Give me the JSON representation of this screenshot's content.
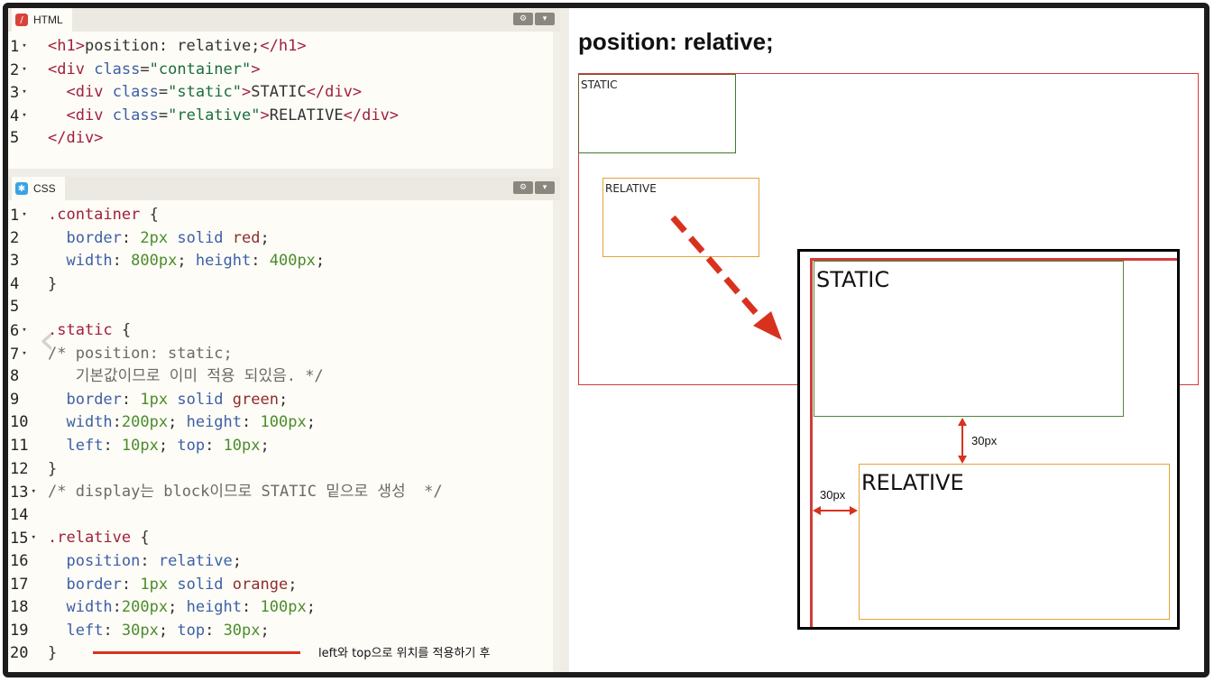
{
  "html_pane": {
    "tab_label": "HTML",
    "tab_icon": "html-icon",
    "settings_icon": "gear-icon",
    "toggle_icon": "chevron-down-icon",
    "lines": [
      {
        "n": "1",
        "fold": true,
        "tokens": [
          [
            "t",
            "<h1>"
          ],
          [
            "d",
            "position: relative;"
          ],
          [
            "t",
            "</h1>"
          ]
        ]
      },
      {
        "n": "2",
        "fold": true,
        "tokens": [
          [
            "t",
            "<div"
          ],
          [
            "d",
            " "
          ],
          [
            "p",
            "class"
          ],
          [
            "d",
            "="
          ],
          [
            "s",
            "\"container\""
          ],
          [
            "t",
            ">"
          ]
        ]
      },
      {
        "n": "3",
        "fold": true,
        "tokens": [
          [
            "d",
            "  "
          ],
          [
            "t",
            "<div"
          ],
          [
            "d",
            " "
          ],
          [
            "p",
            "class"
          ],
          [
            "d",
            "="
          ],
          [
            "s",
            "\"static\""
          ],
          [
            "t",
            ">"
          ],
          [
            "d",
            "STATIC"
          ],
          [
            "t",
            "</div>"
          ]
        ]
      },
      {
        "n": "4",
        "fold": true,
        "tokens": [
          [
            "d",
            "  "
          ],
          [
            "t",
            "<div"
          ],
          [
            "d",
            " "
          ],
          [
            "p",
            "class"
          ],
          [
            "d",
            "="
          ],
          [
            "s",
            "\"relative\""
          ],
          [
            "t",
            ">"
          ],
          [
            "d",
            "RELATIVE"
          ],
          [
            "t",
            "</div>"
          ]
        ]
      },
      {
        "n": "5",
        "fold": false,
        "tokens": [
          [
            "t",
            "</div>"
          ]
        ]
      }
    ]
  },
  "css_pane": {
    "tab_label": "CSS",
    "tab_icon": "css-icon",
    "settings_icon": "gear-icon",
    "toggle_icon": "chevron-down-icon",
    "lines": [
      {
        "n": "1",
        "fold": true,
        "tokens": [
          [
            "sel",
            ".container"
          ],
          [
            "d",
            " {"
          ]
        ]
      },
      {
        "n": "2",
        "fold": false,
        "tokens": [
          [
            "d",
            "  "
          ],
          [
            "p",
            "border"
          ],
          [
            "d",
            ": "
          ],
          [
            "v",
            "2px"
          ],
          [
            "d",
            " "
          ],
          [
            "p",
            "solid"
          ],
          [
            "d",
            " "
          ],
          [
            "k",
            "red"
          ],
          [
            "d",
            ";"
          ]
        ]
      },
      {
        "n": "3",
        "fold": false,
        "tokens": [
          [
            "d",
            "  "
          ],
          [
            "p",
            "width"
          ],
          [
            "d",
            ": "
          ],
          [
            "v",
            "800px"
          ],
          [
            "d",
            "; "
          ],
          [
            "p",
            "height"
          ],
          [
            "d",
            ": "
          ],
          [
            "v",
            "400px"
          ],
          [
            "d",
            ";"
          ]
        ]
      },
      {
        "n": "4",
        "fold": false,
        "tokens": [
          [
            "d",
            "}"
          ]
        ]
      },
      {
        "n": "5",
        "fold": false,
        "tokens": []
      },
      {
        "n": "6",
        "fold": true,
        "tokens": [
          [
            "sel",
            ".static"
          ],
          [
            "d",
            " {"
          ]
        ]
      },
      {
        "n": "7",
        "fold": true,
        "tokens": [
          [
            "c",
            "/* position: static;"
          ]
        ]
      },
      {
        "n": "8",
        "fold": false,
        "tokens": [
          [
            "c",
            "   기본값이므로 이미 적용 되있음. */"
          ]
        ]
      },
      {
        "n": "9",
        "fold": false,
        "tokens": [
          [
            "d",
            "  "
          ],
          [
            "p",
            "border"
          ],
          [
            "d",
            ": "
          ],
          [
            "v",
            "1px"
          ],
          [
            "d",
            " "
          ],
          [
            "p",
            "solid"
          ],
          [
            "d",
            " "
          ],
          [
            "k",
            "green"
          ],
          [
            "d",
            ";"
          ]
        ]
      },
      {
        "n": "10",
        "fold": false,
        "tokens": [
          [
            "d",
            "  "
          ],
          [
            "p",
            "width"
          ],
          [
            "d",
            ":"
          ],
          [
            "v",
            "200px"
          ],
          [
            "d",
            "; "
          ],
          [
            "p",
            "height"
          ],
          [
            "d",
            ": "
          ],
          [
            "v",
            "100px"
          ],
          [
            "d",
            ";"
          ]
        ]
      },
      {
        "n": "11",
        "fold": false,
        "tokens": [
          [
            "d",
            "  "
          ],
          [
            "p",
            "left"
          ],
          [
            "d",
            ": "
          ],
          [
            "v",
            "10px"
          ],
          [
            "d",
            "; "
          ],
          [
            "p",
            "top"
          ],
          [
            "d",
            ": "
          ],
          [
            "v",
            "10px"
          ],
          [
            "d",
            ";"
          ]
        ]
      },
      {
        "n": "12",
        "fold": false,
        "tokens": [
          [
            "d",
            "}"
          ]
        ]
      },
      {
        "n": "13",
        "fold": true,
        "tokens": [
          [
            "c",
            "/* display는 block이므로 STATIC 밑으로 생성  */"
          ]
        ]
      },
      {
        "n": "14",
        "fold": false,
        "tokens": []
      },
      {
        "n": "15",
        "fold": true,
        "tokens": [
          [
            "sel",
            ".relative"
          ],
          [
            "d",
            " {"
          ]
        ]
      },
      {
        "n": "16",
        "fold": false,
        "tokens": [
          [
            "d",
            "  "
          ],
          [
            "p",
            "position"
          ],
          [
            "d",
            ": "
          ],
          [
            "p",
            "relative"
          ],
          [
            "d",
            ";"
          ]
        ]
      },
      {
        "n": "17",
        "fold": false,
        "tokens": [
          [
            "d",
            "  "
          ],
          [
            "p",
            "border"
          ],
          [
            "d",
            ": "
          ],
          [
            "v",
            "1px"
          ],
          [
            "d",
            " "
          ],
          [
            "p",
            "solid"
          ],
          [
            "d",
            " "
          ],
          [
            "k",
            "orange"
          ],
          [
            "d",
            ";"
          ]
        ]
      },
      {
        "n": "18",
        "fold": false,
        "tokens": [
          [
            "d",
            "  "
          ],
          [
            "p",
            "width"
          ],
          [
            "d",
            ":"
          ],
          [
            "v",
            "200px"
          ],
          [
            "d",
            "; "
          ],
          [
            "p",
            "height"
          ],
          [
            "d",
            ": "
          ],
          [
            "v",
            "100px"
          ],
          [
            "d",
            ";"
          ]
        ]
      },
      {
        "n": "19",
        "fold": false,
        "tokens": [
          [
            "d",
            "  "
          ],
          [
            "p",
            "left"
          ],
          [
            "d",
            ": "
          ],
          [
            "v",
            "30px"
          ],
          [
            "d",
            "; "
          ],
          [
            "p",
            "top"
          ],
          [
            "d",
            ": "
          ],
          [
            "v",
            "30px"
          ],
          [
            "d",
            ";"
          ]
        ]
      },
      {
        "n": "20",
        "fold": false,
        "tokens": [
          [
            "d",
            "}"
          ]
        ]
      }
    ]
  },
  "annotation": {
    "text": "left와 top으로 위치를 적용하기 후"
  },
  "preview": {
    "title": "position: relative;",
    "static_label": "STATIC",
    "relative_label": "RELATIVE",
    "zoom": {
      "static_label": "STATIC",
      "relative_label": "RELATIVE",
      "offset_top_label": "30px",
      "offset_left_label": "30px"
    }
  },
  "colors": {
    "container_border": "#d23b3b",
    "static_border": "#4a8a34",
    "relative_border": "#e4a33a",
    "arrow": "#d8321f"
  }
}
